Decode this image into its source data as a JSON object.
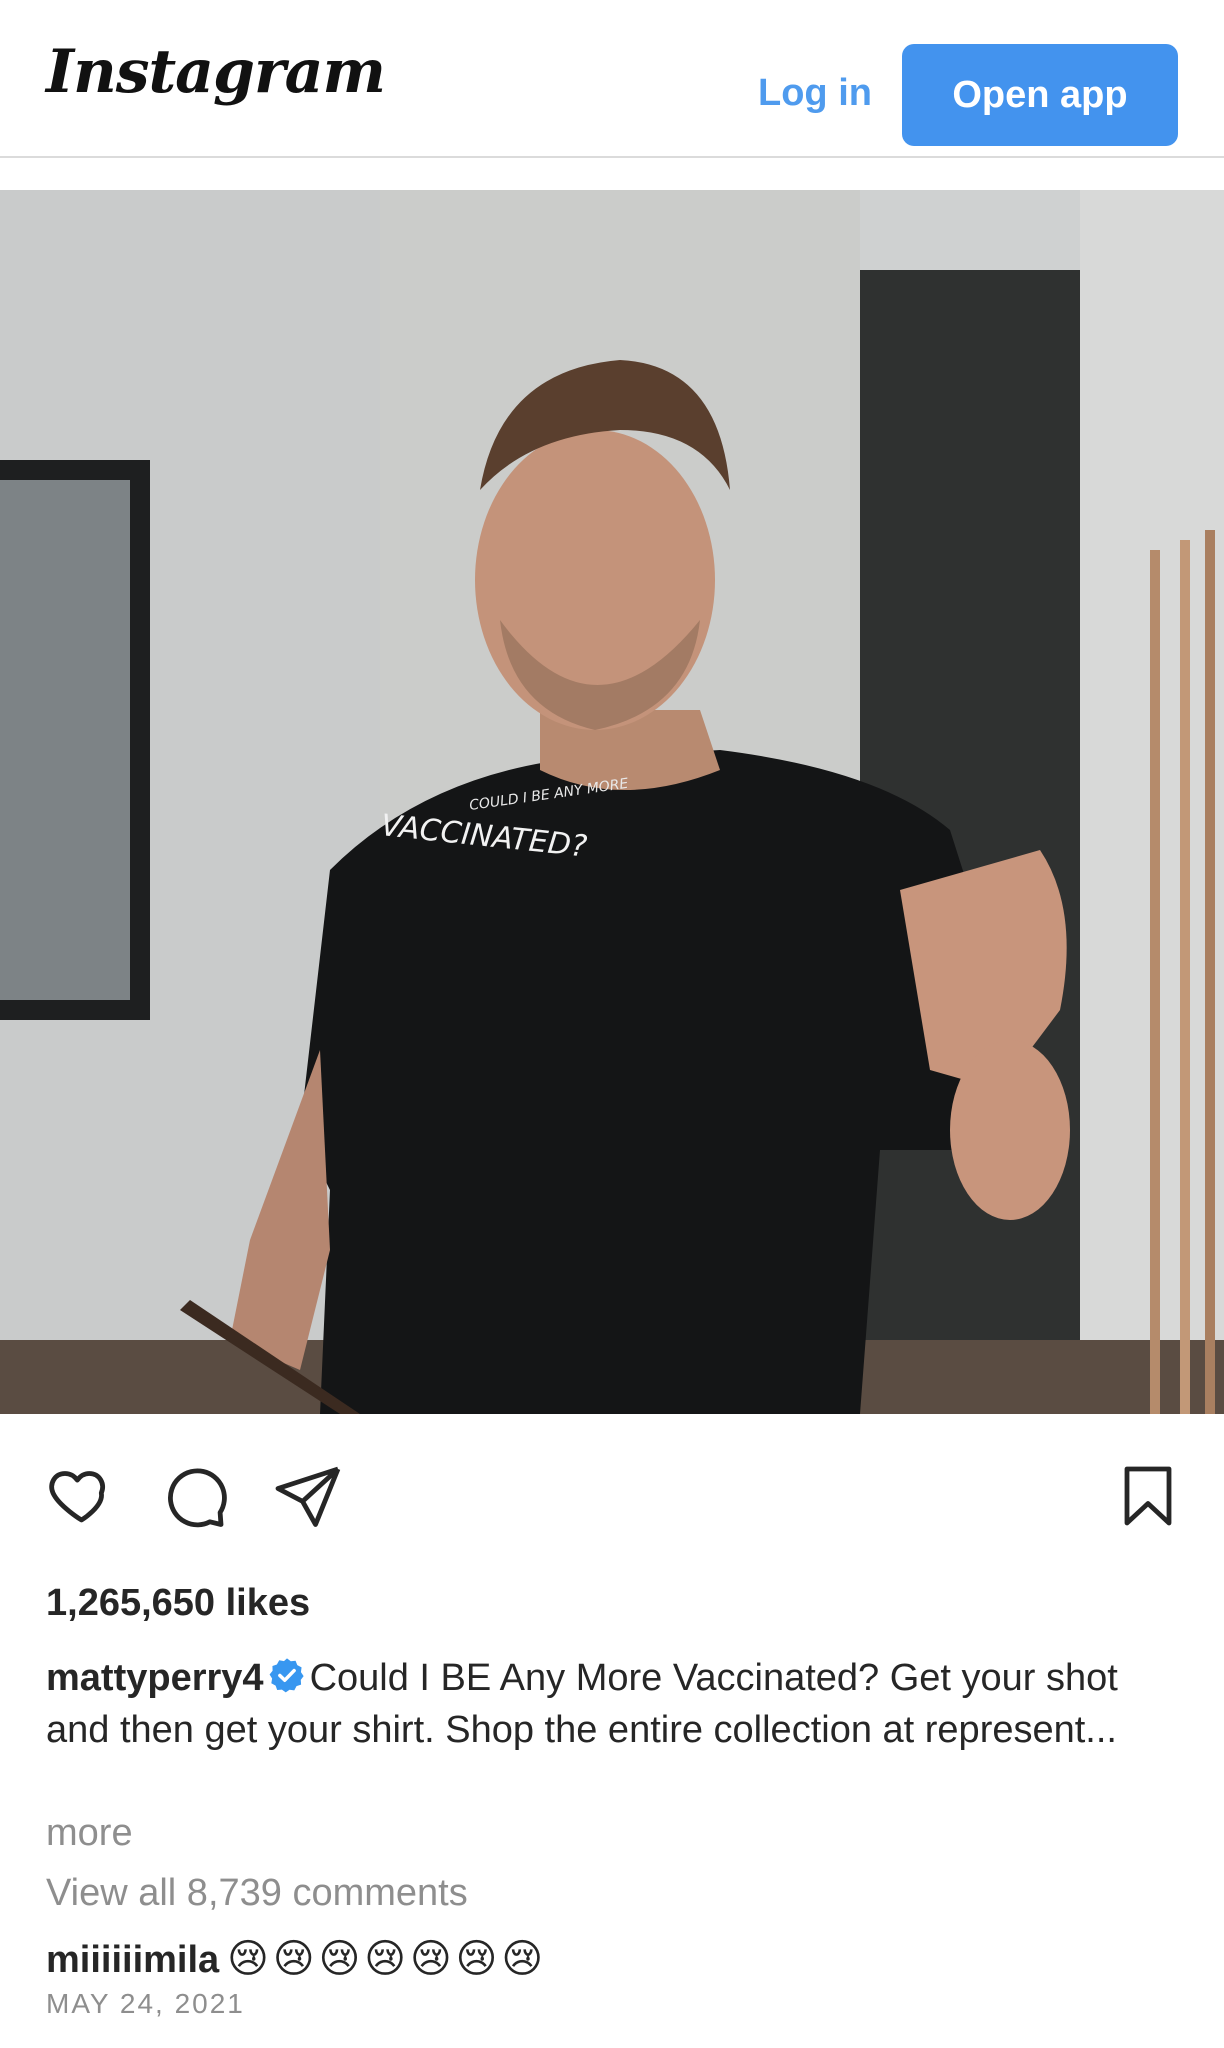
{
  "header": {
    "logo": "Instagram",
    "login_label": "Log in",
    "open_app_label": "Open app"
  },
  "post": {
    "shirt_text_top": "COULD I BE ANY MORE",
    "shirt_text_main": "VACCINATED?",
    "likes": "1,265,650 likes",
    "username": "mattyperry4",
    "caption": "Could I BE Any More Vaccinated? Get your shot and then get your shirt. Shop the entire collection at represent...",
    "more_label": "more",
    "view_all_comments": "View all 8,739 comments",
    "top_comment": {
      "username": "miiiiiimila",
      "text": "😢😢😢😢😢😢😢"
    },
    "date": "MAY 24, 2021"
  },
  "icons": {
    "like": "heart-icon",
    "comment": "comment-bubble-icon",
    "share": "paper-plane-icon",
    "save": "bookmark-icon",
    "verified": "verified-badge-icon"
  },
  "colors": {
    "accent": "#4393ee",
    "login_text": "#4f9bee",
    "verified": "#3897f0",
    "muted_text": "#8e8e8e"
  }
}
